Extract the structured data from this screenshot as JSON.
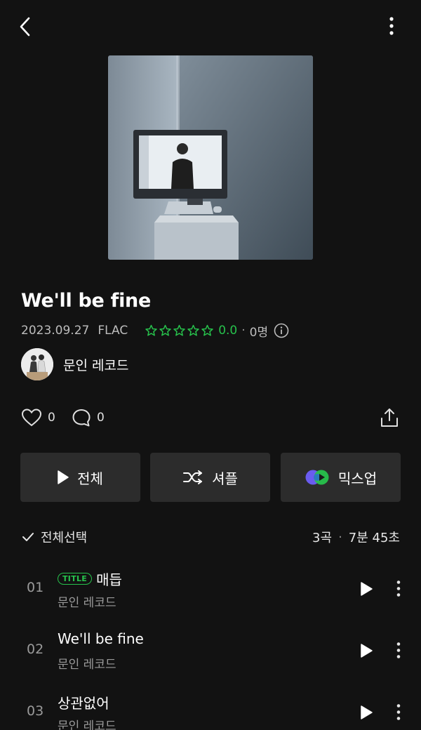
{
  "album": {
    "title": "We'll be fine",
    "release_date": "2023.09.27",
    "format": "FLAC",
    "rating_score": "0.0",
    "rating_count": "0명",
    "artist": "문인 레코드",
    "likes": "0",
    "comments": "0"
  },
  "buttons": {
    "play_all": "전체",
    "shuffle": "셔플",
    "mixup": "믹스업"
  },
  "list_header": {
    "select_all": "전체선택",
    "track_count": "3곡",
    "total_duration": "7분 45초"
  },
  "tracks": [
    {
      "number": "01",
      "title": "매듭",
      "artist": "문인 레코드",
      "badge": "TITLE"
    },
    {
      "number": "02",
      "title": "We'll be fine",
      "artist": "문인 레코드",
      "badge": ""
    },
    {
      "number": "03",
      "title": "상관없어",
      "artist": "문인 레코드",
      "badge": ""
    }
  ],
  "colors": {
    "background": "#121212",
    "accent_green": "#27c24c",
    "button_bg": "#2c2c2c",
    "secondary_text": "#9a9a9a"
  },
  "icons": [
    "back-arrow-icon",
    "more-vertical-icon",
    "star-outline-icon",
    "info-icon",
    "heart-outline-icon",
    "comment-icon",
    "share-icon",
    "play-icon",
    "shuffle-icon",
    "mixup-logo-icon",
    "checkmark-icon"
  ]
}
